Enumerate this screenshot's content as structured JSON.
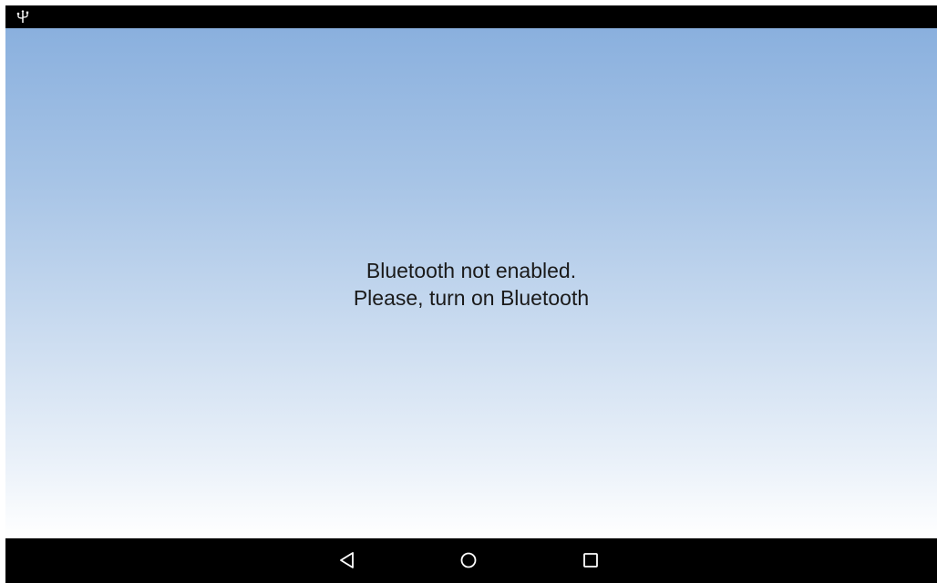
{
  "status_bar": {
    "icons": [
      "usb-icon"
    ]
  },
  "message": {
    "line1": "Bluetooth not enabled.",
    "line2": "Please, turn on Bluetooth"
  },
  "nav_bar": {
    "buttons": [
      "back-icon",
      "home-icon",
      "recents-icon"
    ]
  },
  "colors": {
    "gradient_top": "#8ab0de",
    "gradient_bottom": "#ffffff",
    "bars": "#000000",
    "text": "#1a1a1a"
  }
}
